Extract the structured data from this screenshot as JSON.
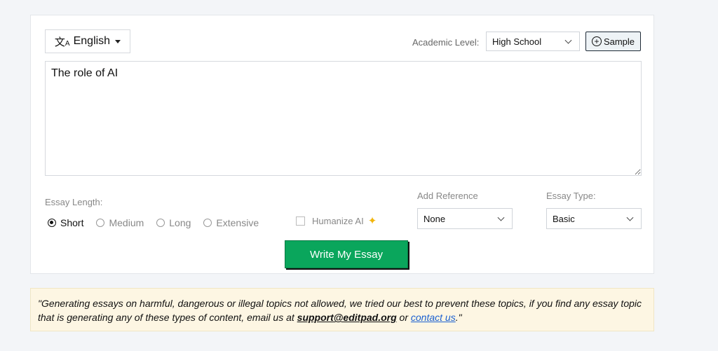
{
  "toolbar": {
    "language_label": "English",
    "academic_level_label": "Academic Level:",
    "academic_level_value": "High School",
    "sample_label": "Sample"
  },
  "topic": {
    "value": "The role of AI"
  },
  "essay_length": {
    "label": "Essay Length:",
    "options": [
      "Short",
      "Medium",
      "Long",
      "Extensive"
    ],
    "selected": "Short"
  },
  "humanize": {
    "label": "Humanize AI",
    "checked": false
  },
  "reference": {
    "label": "Add Reference",
    "value": "None"
  },
  "essay_type": {
    "label": "Essay Type:",
    "value": "Basic"
  },
  "submit": {
    "label": "Write My Essay"
  },
  "notice": {
    "text_before": "\"Generating essays on harmful, dangerous or illegal topics not allowed, we tried our best to prevent these topics, if you find any essay topic that is generating any of these types of content, email us at ",
    "email": "support@editpad.org",
    "text_middle": " or ",
    "contact_link": "contact us",
    "text_after": ".\""
  },
  "colors": {
    "primary_button": "#0aa65c",
    "notice_bg": "#fdf6e3",
    "link": "#1a5fd0",
    "sparkle": "#f2b50c"
  }
}
